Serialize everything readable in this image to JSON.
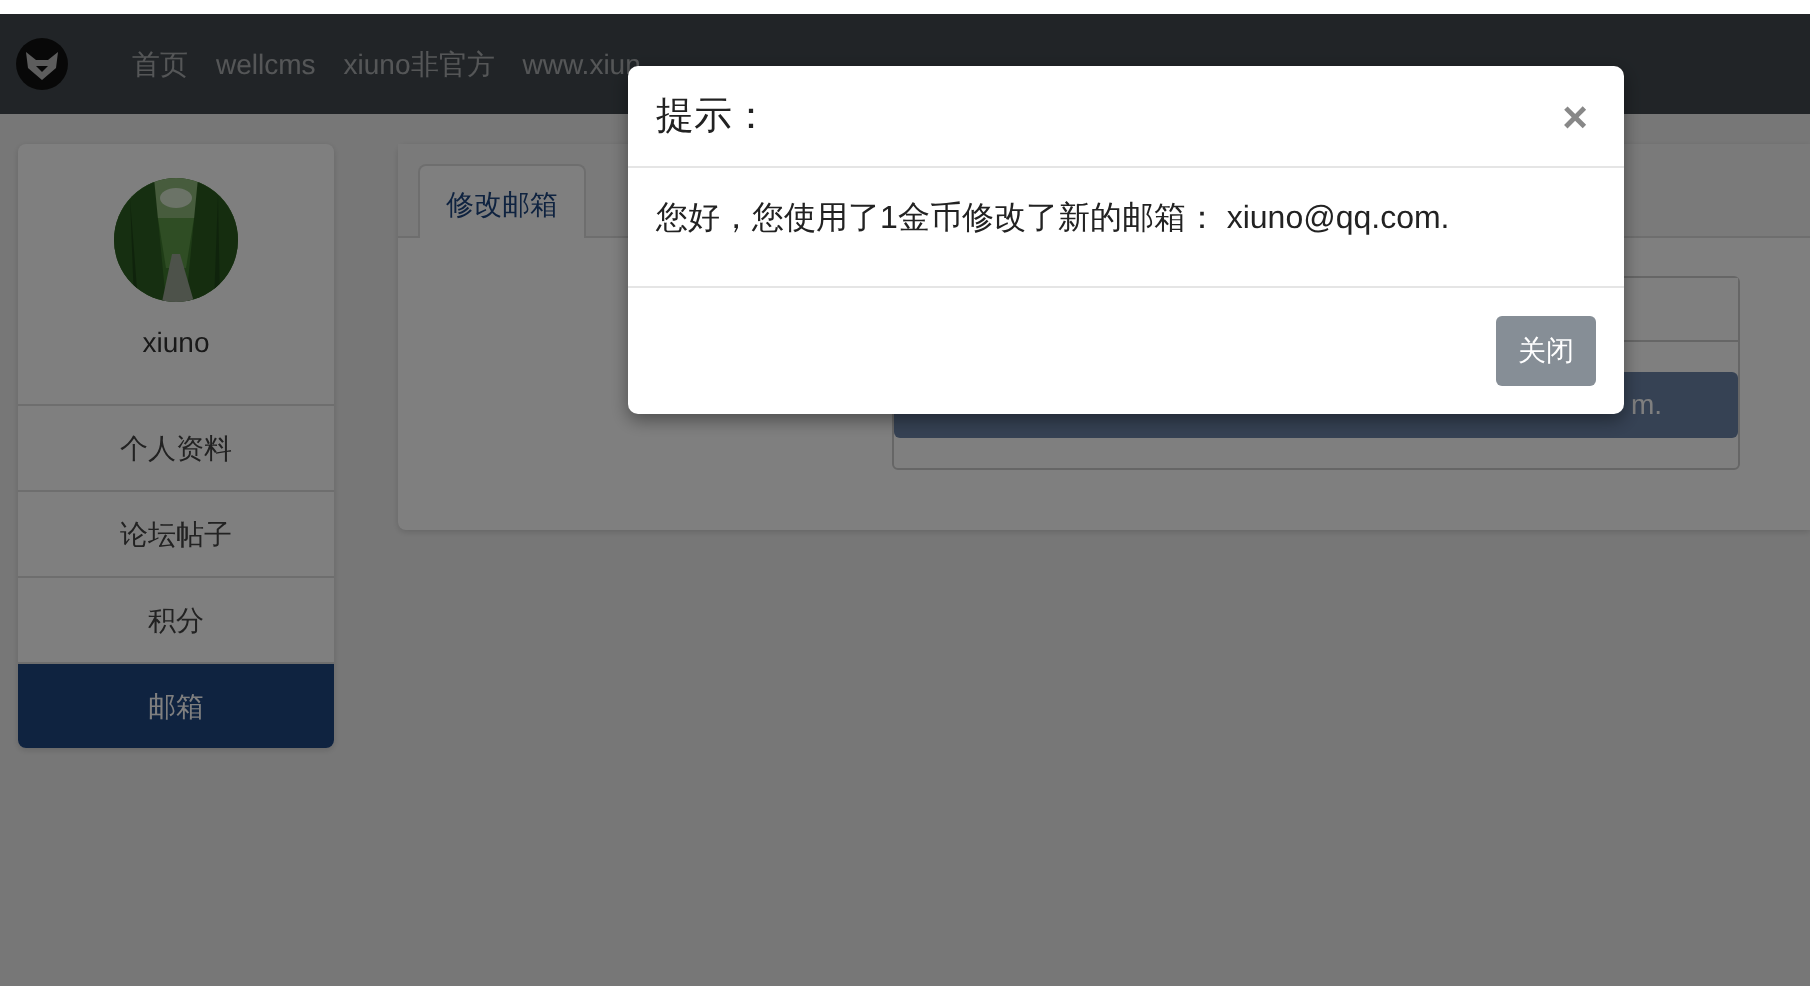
{
  "navbar": {
    "items": [
      {
        "label": "首页"
      },
      {
        "label": "wellcms"
      },
      {
        "label": "xiuno非官方"
      },
      {
        "label": "www.xiun"
      }
    ]
  },
  "sidebar": {
    "username": "xiuno",
    "items": [
      {
        "label": "个人资料",
        "selected": false
      },
      {
        "label": "论坛帖子",
        "selected": false
      },
      {
        "label": "积分",
        "selected": false
      },
      {
        "label": "邮箱",
        "selected": true
      }
    ]
  },
  "content": {
    "tabs": [
      {
        "label": "修改邮箱",
        "selected": true
      }
    ],
    "form": {
      "submit_label": "m."
    }
  },
  "modal": {
    "title": "提示：",
    "close": "×",
    "message": "您好，您使用了1金币修改了新的邮箱： xiuno@qq.com.",
    "buttons": [
      "关闭"
    ]
  }
}
